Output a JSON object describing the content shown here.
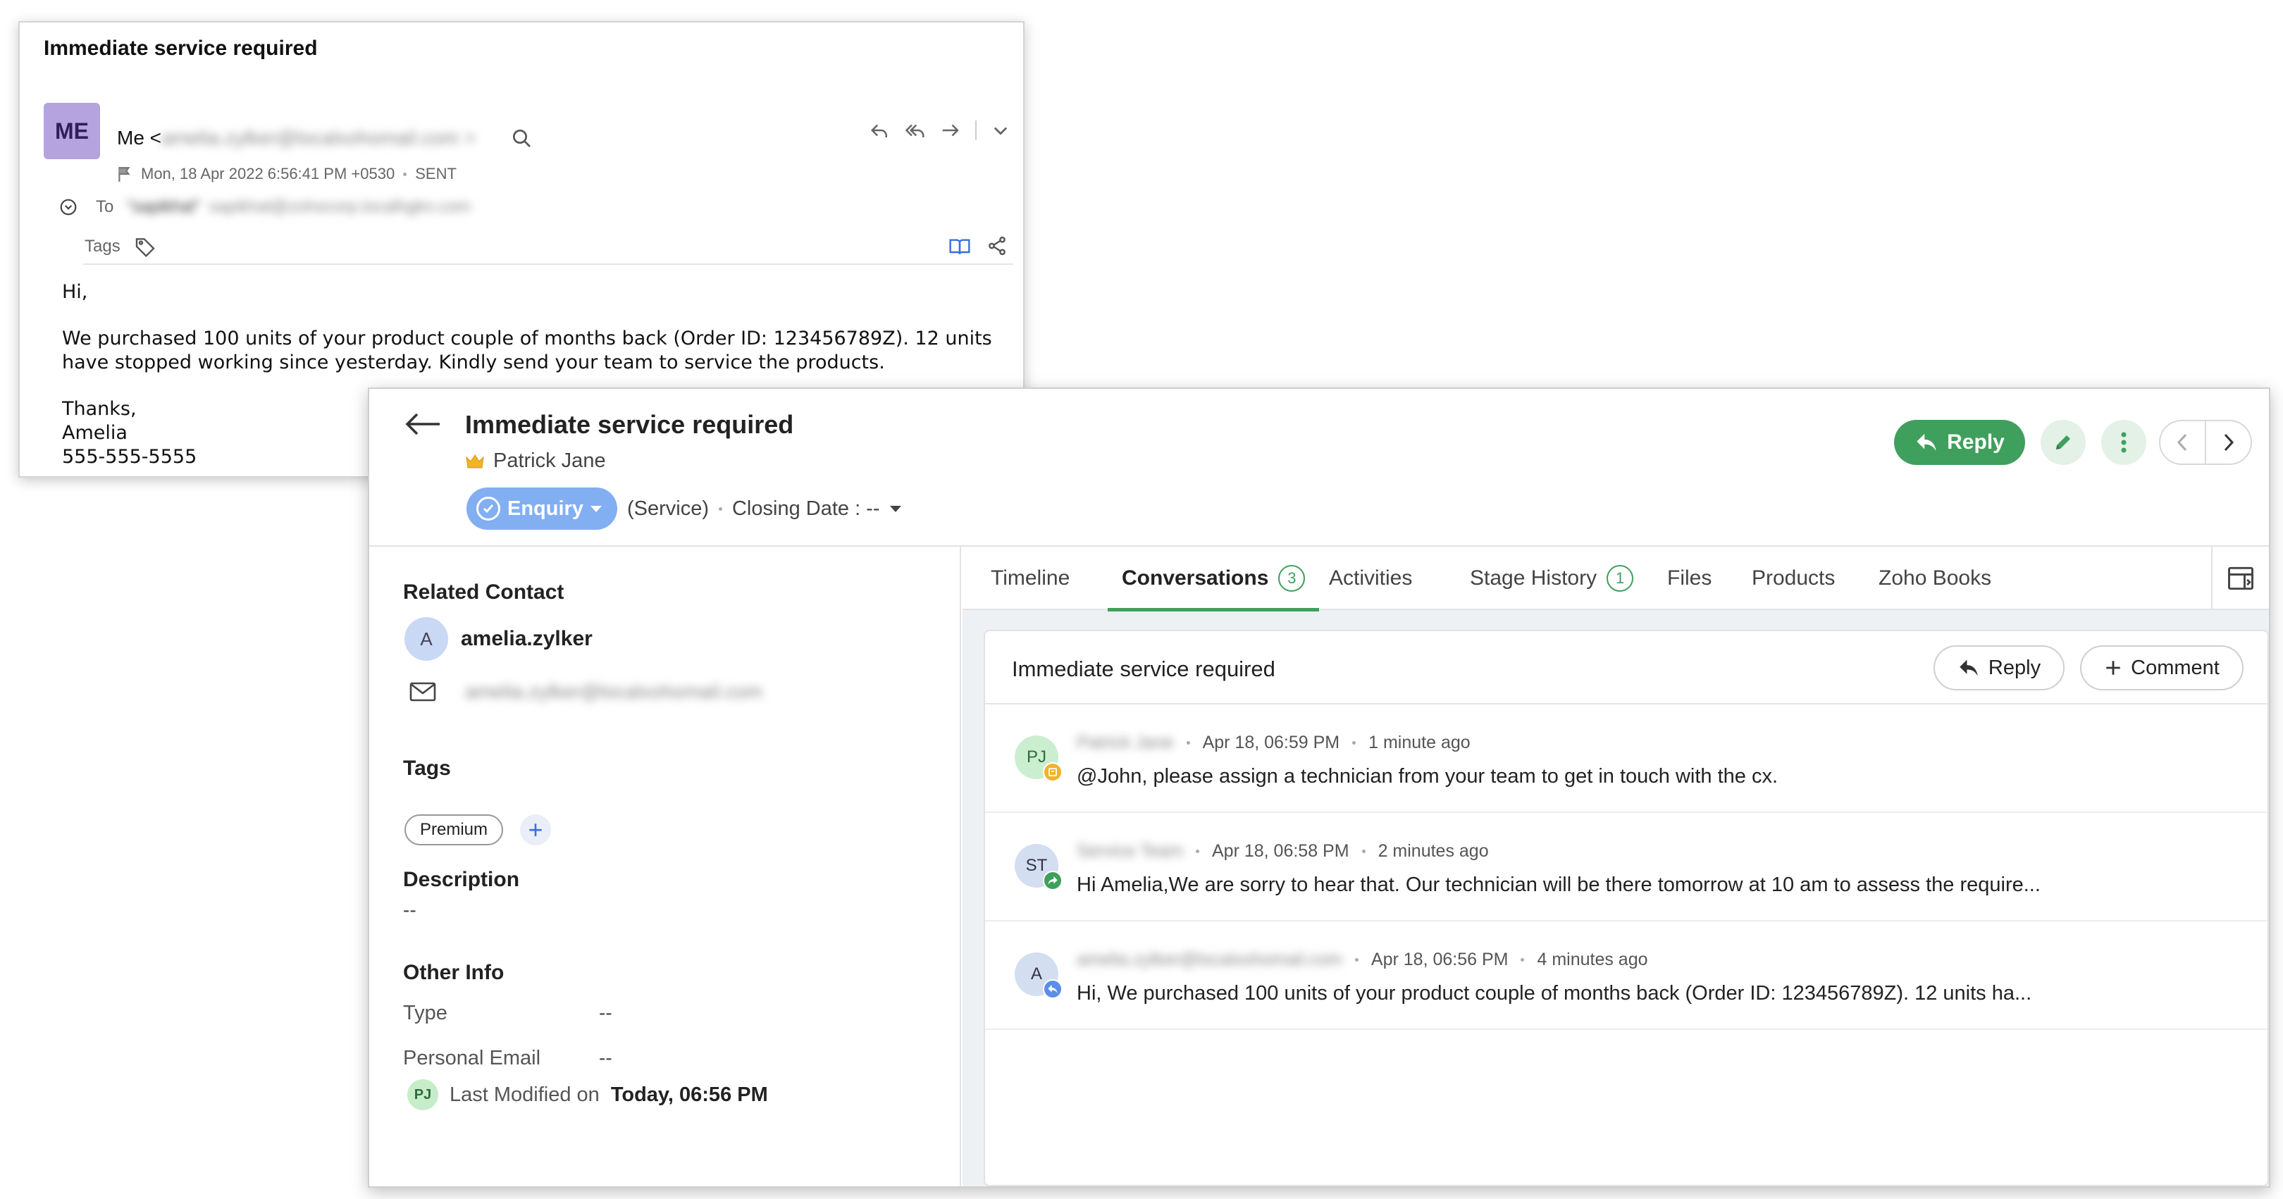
{
  "email": {
    "subject": "Immediate service required",
    "avatar_initials": "ME",
    "from_label": "Me <",
    "from_address": "amelia.zylker@localxohomail.com >",
    "date": "Mon, 18 Apr 2022 6:56:41 PM +0530",
    "status": "SENT",
    "to_label": "To",
    "to_name": "\"sapikhal\"",
    "to_address": "sapikhal@zohocorp.localhgkn.com",
    "tags_label": "Tags",
    "body": {
      "greeting": "Hi,",
      "line1": "We purchased 100 units of your product couple of months back (Order ID: 123456789Z). 12 units",
      "line2": "have stopped working since yesterday. Kindly send your team to service the products.",
      "closing": "Thanks,",
      "name": "Amelia",
      "phone": "555-555-5555"
    }
  },
  "deal": {
    "title": "Immediate service required",
    "owner": "Patrick Jane",
    "stage": "Enquiry",
    "type": "(Service)",
    "closing_date": "Closing Date : --",
    "reply_label": "Reply"
  },
  "left": {
    "related_contact_label": "Related Contact",
    "contact_initial": "A",
    "contact_name": "amelia.zylker",
    "contact_email": "amelia.zylker@localxohomail.com",
    "tags_label": "Tags",
    "tag": "Premium",
    "add_tag": "+",
    "description_label": "Description",
    "description_value": "--",
    "other_info_label": "Other Info",
    "type_label": "Type",
    "type_value": "--",
    "personal_email_label": "Personal Email",
    "personal_email_value": "--",
    "modified_initials": "PJ",
    "last_modified_label": "Last Modified on",
    "last_modified_value": "Today, 06:56 PM"
  },
  "tabs": [
    {
      "label": "Timeline"
    },
    {
      "label": "Conversations",
      "count": "3"
    },
    {
      "label": "Activities"
    },
    {
      "label": "Stage History",
      "count": "1"
    },
    {
      "label": "Files"
    },
    {
      "label": "Products"
    },
    {
      "label": "Zoho Books"
    }
  ],
  "conversations": {
    "title": "Immediate service required",
    "reply_label": "Reply",
    "comment_label": "Comment",
    "items": [
      {
        "initials": "PJ",
        "sender": "Patrick Jane",
        "date": "Apr 18, 06:59 PM",
        "ago": "1 minute ago",
        "text": "@John, please assign a technician from your team to get in touch with the cx."
      },
      {
        "initials": "ST",
        "sender": "Service Team",
        "date": "Apr 18, 06:58 PM",
        "ago": "2 minutes ago",
        "text": "Hi Amelia,We are sorry to hear that. Our technician will be there tomorrow at 10 am to assess the require..."
      },
      {
        "initials": "A",
        "sender": "amelia.zylker@localxohomail.com",
        "date": "Apr 18, 06:56 PM",
        "ago": "4 minutes ago",
        "text": "Hi, We purchased 100 units of your product couple of months back (Order ID: 123456789Z). 12 units ha..."
      }
    ]
  },
  "colors": {
    "accent_green": "#3f9f5c",
    "stage_blue": "#82aef2",
    "avatar_purple": "#b5a3df"
  }
}
